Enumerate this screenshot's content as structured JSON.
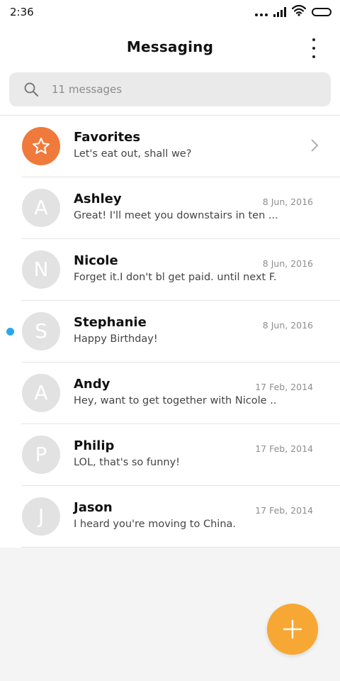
{
  "status_bar": {
    "time": "2:36"
  },
  "header": {
    "title": "Messaging"
  },
  "search": {
    "placeholder": "11 messages"
  },
  "favorites": {
    "name": "Favorites",
    "snippet": "Let's eat out, shall we?"
  },
  "conversations": [
    {
      "initial": "A",
      "name": "Ashley",
      "date": "8 Jun, 2016",
      "snippet": "Great! I'll meet you downstairs in ten ...",
      "unread": false
    },
    {
      "initial": "N",
      "name": "Nicole",
      "date": "8 Jun, 2016",
      "snippet": "Forget it.I don't bl get paid. until next F...",
      "unread": false
    },
    {
      "initial": "S",
      "name": "Stephanie",
      "date": "8 Jun, 2016",
      "snippet": "Happy Birthday!",
      "unread": true
    },
    {
      "initial": "A",
      "name": "Andy",
      "date": "17 Feb, 2014",
      "snippet": "Hey, want to get together with Nicole ...",
      "unread": false
    },
    {
      "initial": "P",
      "name": "Philip",
      "date": "17 Feb, 2014",
      "snippet": "LOL, that's so funny!",
      "unread": false
    },
    {
      "initial": "J",
      "name": "Jason",
      "date": "17 Feb, 2014",
      "snippet": "I heard you're moving to China.",
      "unread": false
    }
  ],
  "colors": {
    "favorites_avatar": "#f07a3c",
    "unread_dot": "#2aa6ee",
    "fab": "#f7a733"
  },
  "icons": [
    "signal-dots-icon",
    "cellular-signal-icon",
    "wifi-icon",
    "battery-icon",
    "more-vertical-icon",
    "search-icon",
    "star-icon",
    "chevron-right-icon",
    "plus-icon"
  ]
}
